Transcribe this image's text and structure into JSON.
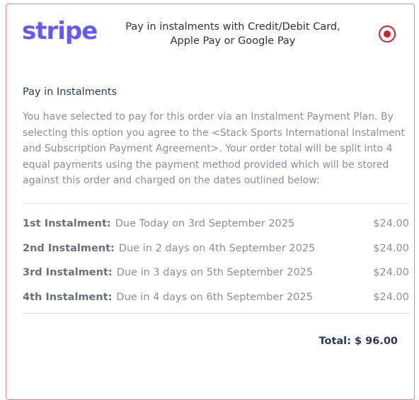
{
  "brand": {
    "logo_text": "stripe",
    "logo_color": "#635bff"
  },
  "payment_method": {
    "label_line1": "Pay in instalments with Credit/Debit Card,",
    "label_line2": "Apple Pay or Google Pay",
    "selected": true,
    "radio_color": "#d4202a"
  },
  "plan": {
    "title": "Pay in Instalments",
    "description": "You have selected to pay for this order via an Instalment Payment Plan. By selecting this option you agree to the <Stack Sports International Instalment and Subscription Payment Agreement>. Your order total will be split into 4 equal payments using the payment method provided which will be stored against this order and charged on the dates outlined below:",
    "instalments": [
      {
        "label": "1st Instalment:",
        "due": "Due Today on 3rd September 2025",
        "amount": "$24.00"
      },
      {
        "label": "2nd Instalment:",
        "due": "Due in 2 days on 4th September 2025",
        "amount": "$24.00"
      },
      {
        "label": "3rd Instalment:",
        "due": "Due in 3 days on 5th September 2025",
        "amount": "$24.00"
      },
      {
        "label": "4th Instalment:",
        "due": "Due in 4 days on 6th September 2025",
        "amount": "$24.00"
      }
    ],
    "total": "Total: $ 96.00"
  }
}
